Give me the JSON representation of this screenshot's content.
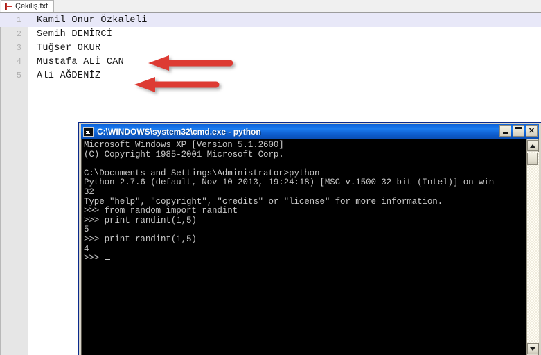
{
  "editor": {
    "tab": {
      "label": "Çekiliş.txt",
      "icon": "floppy-save-icon"
    },
    "lines": [
      {
        "number": "1",
        "text": "Kamil Onur Özkaleli",
        "current": true
      },
      {
        "number": "2",
        "text": "Semih DEMİRCİ",
        "current": false
      },
      {
        "number": "3",
        "text": "Tuğser OKUR",
        "current": false
      },
      {
        "number": "4",
        "text": "Mustafa ALİ CAN",
        "current": false
      },
      {
        "number": "5",
        "text": "Ali AĞDENİZ",
        "current": false
      }
    ],
    "current_line_highlight_color": "#e8e8f8",
    "gutter_color": "#e6e6e6"
  },
  "annotations": {
    "arrow_color": "#dd3b33",
    "arrows": [
      {
        "name": "arrow-pointing-line-4",
        "direction": "left"
      },
      {
        "name": "arrow-pointing-line-5",
        "direction": "left"
      }
    ]
  },
  "cmd_window": {
    "icon": "cmd-console-icon",
    "title": "C:\\WINDOWS\\system32\\cmd.exe - python",
    "titlebar_color": "#0b60d6",
    "buttons": {
      "minimize": "–",
      "maximize": "□",
      "close": "✕"
    },
    "console_lines": [
      "Microsoft Windows XP [Version 5.1.2600]",
      "(C) Copyright 1985-2001 Microsoft Corp.",
      "",
      "C:\\Documents and Settings\\Administrator>python",
      "Python 2.7.6 (default, Nov 10 2013, 19:24:18) [MSC v.1500 32 bit (Intel)] on win",
      "32",
      "Type \"help\", \"copyright\", \"credits\" or \"license\" for more information.",
      ">>> from random import randint",
      ">>> print randint(1,5)",
      "5",
      ">>> print randint(1,5)",
      "4"
    ],
    "prompt": ">>> ",
    "scrollbar": {
      "up_arrow": "▲",
      "down_arrow": "▼"
    }
  }
}
